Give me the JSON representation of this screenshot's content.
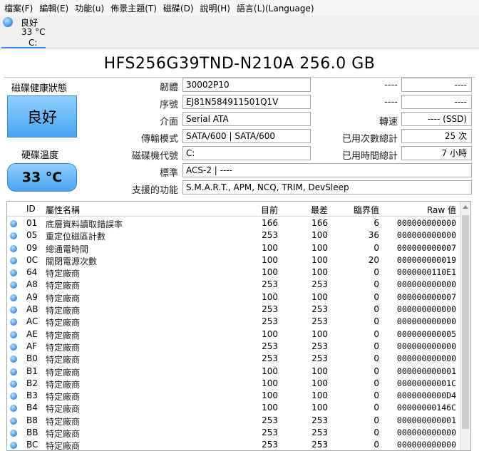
{
  "menu": [
    "檔案(F)",
    "編輯(E)",
    "功能(u)",
    "佈景主題(T)",
    "磁碟(D)",
    "說明(H)",
    "語言(L)(Language)"
  ],
  "disk_tab": {
    "status": "良好",
    "temp": "33 °C",
    "drive": "C:"
  },
  "title": "HFS256G39TND-N210A 256.0 GB",
  "health": {
    "label": "磁碟健康狀態",
    "value": "良好"
  },
  "temperature": {
    "label": "硬碟溫度",
    "value": "33 °C"
  },
  "fields": {
    "firmware": {
      "label": "韌體",
      "value": "30002P10"
    },
    "serial": {
      "label": "序號",
      "value": "EJ81N584911501Q1V"
    },
    "interface": {
      "label": "介面",
      "value": "Serial ATA"
    },
    "transfer": {
      "label": "傳輸模式",
      "value": "SATA/600 | SATA/600"
    },
    "drive_letter": {
      "label": "磁碟機代號",
      "value": "C:"
    },
    "standard": {
      "label": "標準",
      "value": "ACS-2 | ----"
    },
    "features": {
      "label": "支援的功能",
      "value": "S.M.A.R.T., APM, NCQ, TRIM, DevSleep"
    }
  },
  "right_fields": {
    "blank1": {
      "label": "----",
      "value": "----"
    },
    "blank2": {
      "label": "----",
      "value": "----"
    },
    "rotation": {
      "label": "轉速",
      "value": "---- (SSD)"
    },
    "power_on_count": {
      "label": "已用次數總計",
      "value": "25 次"
    },
    "power_on_hours": {
      "label": "已用時間總計",
      "value": "7 小時"
    }
  },
  "table": {
    "headers": {
      "id": "ID",
      "name": "屬性名稱",
      "current": "目前",
      "worst": "最差",
      "threshold": "臨界值",
      "raw": "Raw 值"
    },
    "rows": [
      {
        "id": "01",
        "name": "底層資料讀取錯誤率",
        "current": "166",
        "worst": "166",
        "threshold": "6",
        "raw": "000000000000"
      },
      {
        "id": "05",
        "name": "重定位磁區計數",
        "current": "253",
        "worst": "100",
        "threshold": "36",
        "raw": "000000000000"
      },
      {
        "id": "09",
        "name": "總通電時間",
        "current": "100",
        "worst": "100",
        "threshold": "0",
        "raw": "000000000007"
      },
      {
        "id": "0C",
        "name": "關閉電源次數",
        "current": "100",
        "worst": "100",
        "threshold": "20",
        "raw": "000000000019"
      },
      {
        "id": "64",
        "name": "特定廠商",
        "current": "100",
        "worst": "100",
        "threshold": "0",
        "raw": "0000000110E1"
      },
      {
        "id": "A8",
        "name": "特定廠商",
        "current": "253",
        "worst": "253",
        "threshold": "0",
        "raw": "000000000000"
      },
      {
        "id": "A9",
        "name": "特定廠商",
        "current": "100",
        "worst": "100",
        "threshold": "0",
        "raw": "000000000007"
      },
      {
        "id": "AB",
        "name": "特定廠商",
        "current": "253",
        "worst": "253",
        "threshold": "0",
        "raw": "000000000000"
      },
      {
        "id": "AC",
        "name": "特定廠商",
        "current": "253",
        "worst": "253",
        "threshold": "0",
        "raw": "000000000000"
      },
      {
        "id": "AE",
        "name": "特定廠商",
        "current": "100",
        "worst": "100",
        "threshold": "0",
        "raw": "000000000005"
      },
      {
        "id": "AF",
        "name": "特定廠商",
        "current": "253",
        "worst": "253",
        "threshold": "0",
        "raw": "000000000000"
      },
      {
        "id": "B0",
        "name": "特定廠商",
        "current": "253",
        "worst": "253",
        "threshold": "0",
        "raw": "000000000000"
      },
      {
        "id": "B1",
        "name": "特定廠商",
        "current": "100",
        "worst": "100",
        "threshold": "0",
        "raw": "000000000001"
      },
      {
        "id": "B2",
        "name": "特定廠商",
        "current": "100",
        "worst": "100",
        "threshold": "0",
        "raw": "00000000001C"
      },
      {
        "id": "B3",
        "name": "特定廠商",
        "current": "100",
        "worst": "100",
        "threshold": "0",
        "raw": "0000000000D4"
      },
      {
        "id": "B4",
        "name": "特定廠商",
        "current": "100",
        "worst": "100",
        "threshold": "0",
        "raw": "00000000146C"
      },
      {
        "id": "B8",
        "name": "特定廠商",
        "current": "253",
        "worst": "253",
        "threshold": "0",
        "raw": "000000000001"
      },
      {
        "id": "BB",
        "name": "特定廠商",
        "current": "253",
        "worst": "253",
        "threshold": "0",
        "raw": "000000000000"
      },
      {
        "id": "BC",
        "name": "特定廠商",
        "current": "253",
        "worst": "253",
        "threshold": "0",
        "raw": "000000000000"
      }
    ]
  }
}
